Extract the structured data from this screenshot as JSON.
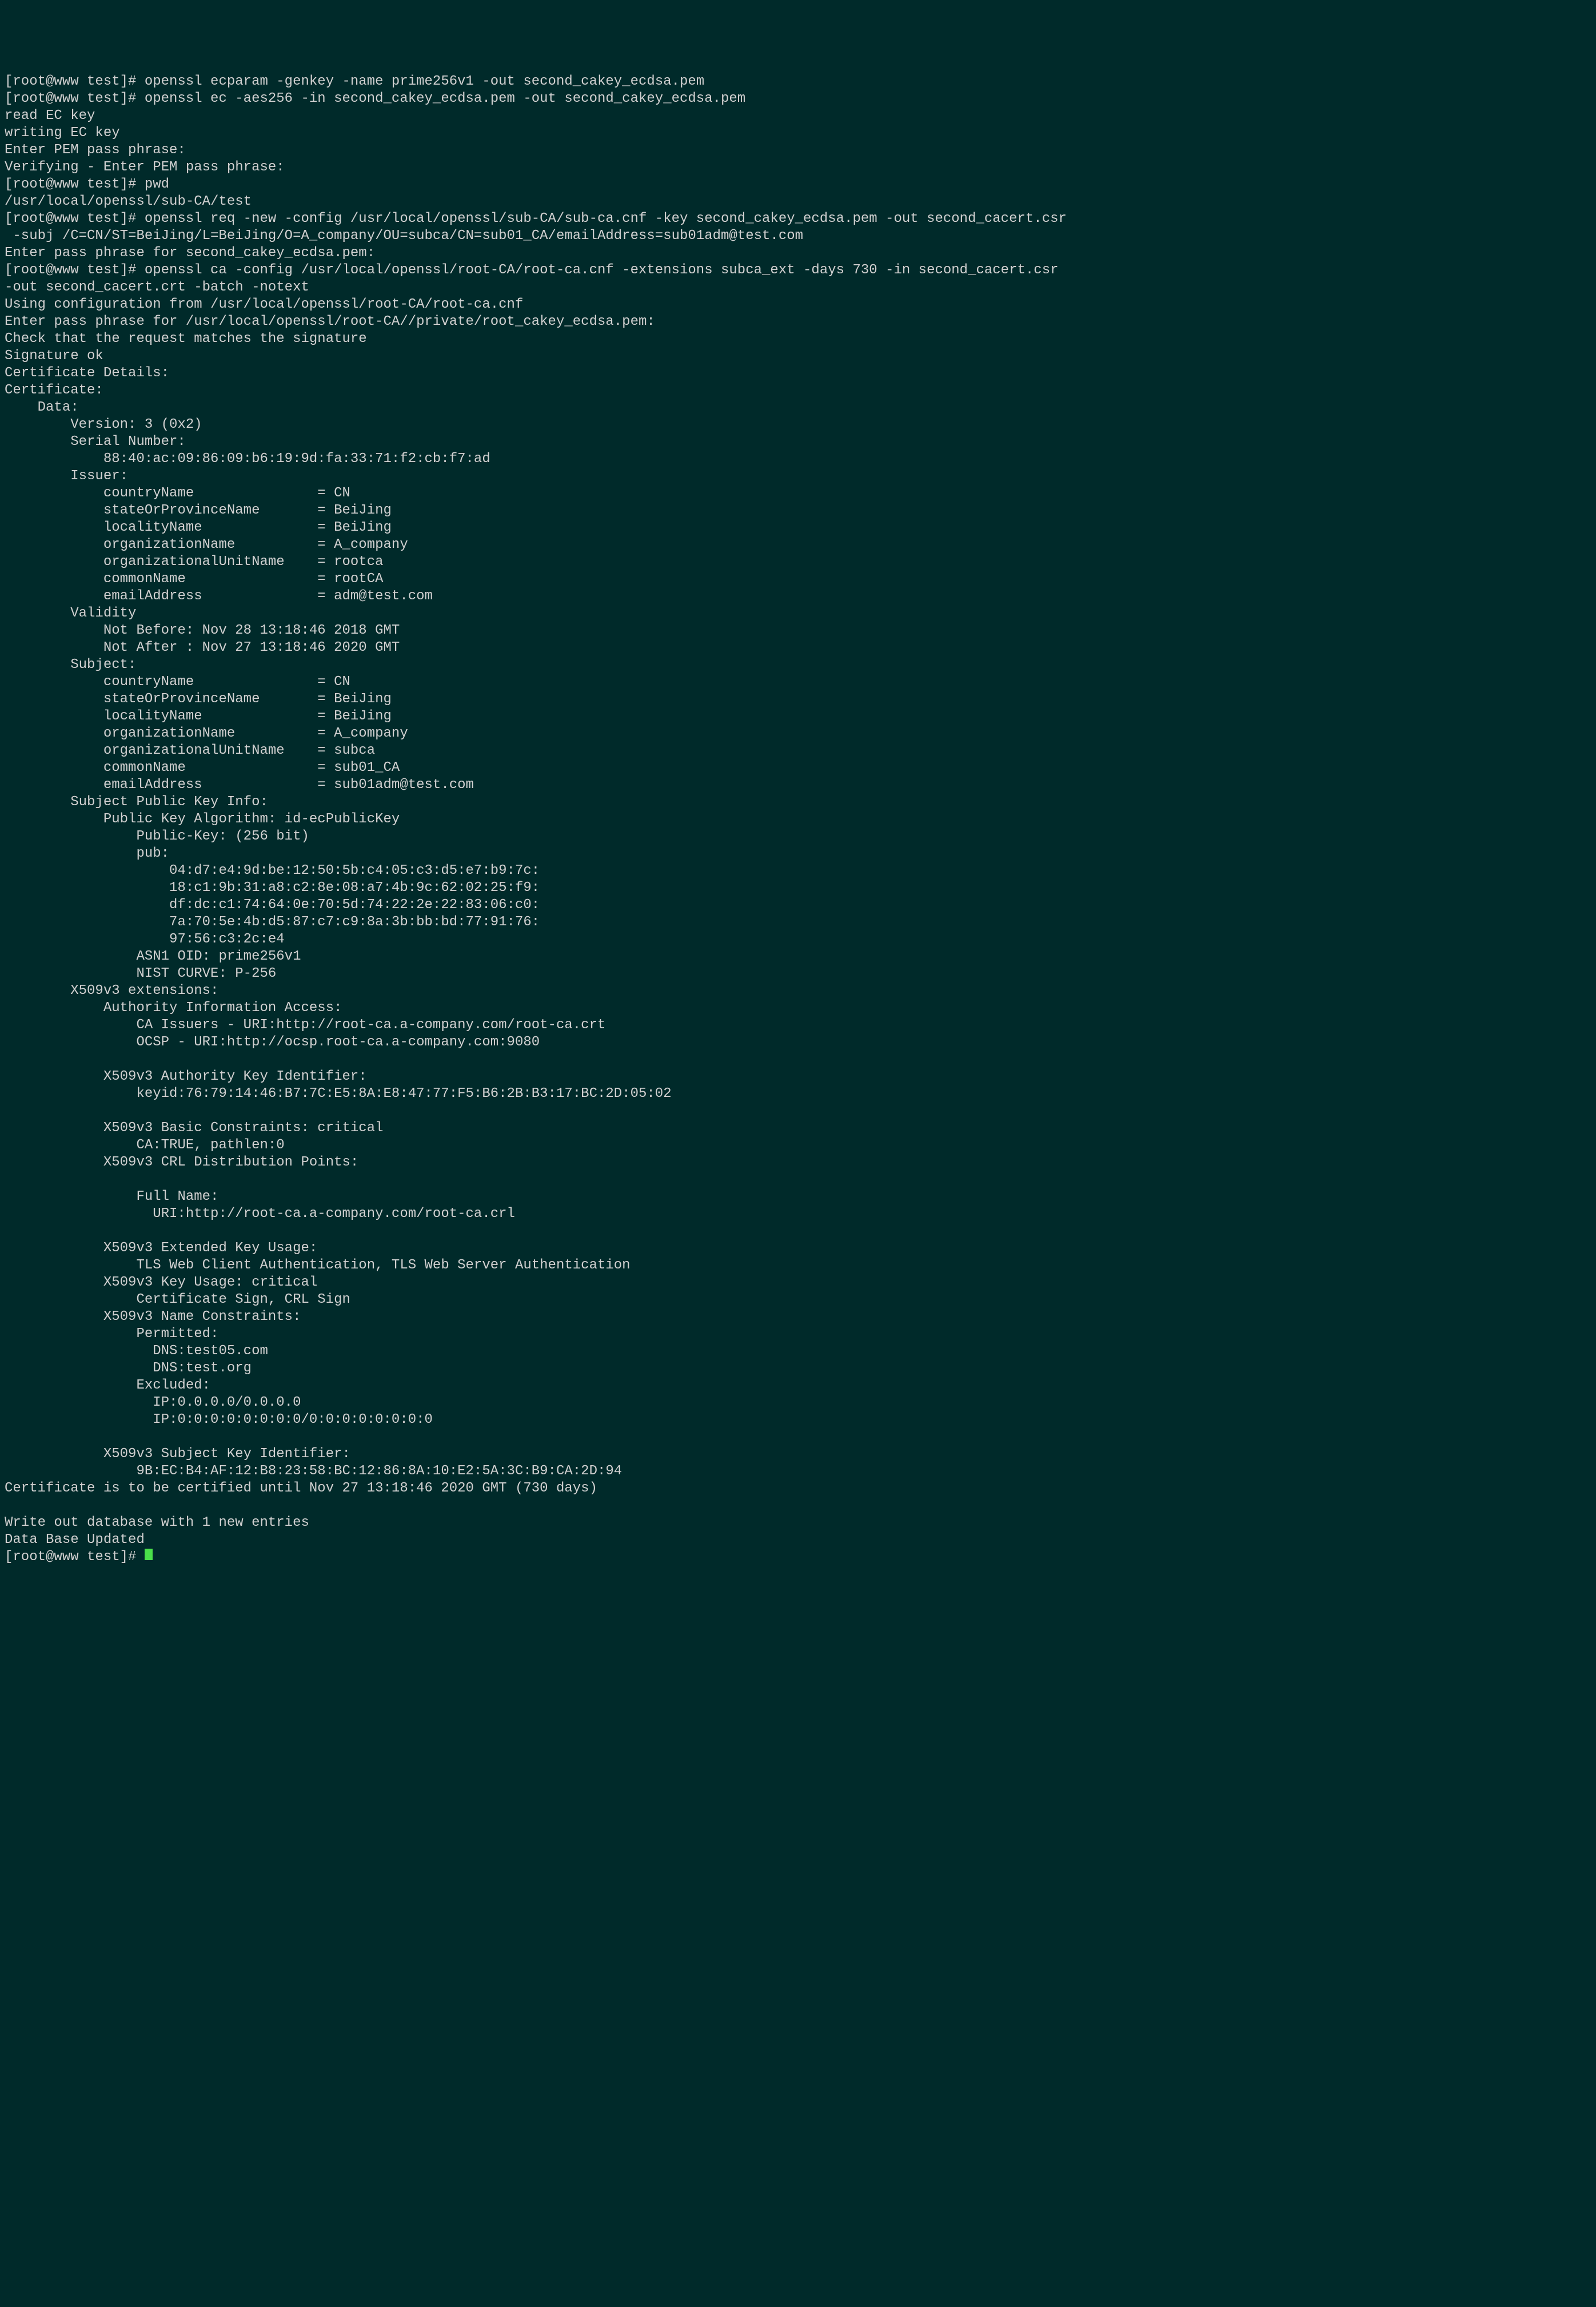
{
  "terminal": {
    "lines": [
      "[root@www test]# openssl ecparam -genkey -name prime256v1 -out second_cakey_ecdsa.pem",
      "[root@www test]# openssl ec -aes256 -in second_cakey_ecdsa.pem -out second_cakey_ecdsa.pem",
      "read EC key",
      "writing EC key",
      "Enter PEM pass phrase:",
      "Verifying - Enter PEM pass phrase:",
      "[root@www test]# pwd",
      "/usr/local/openssl/sub-CA/test",
      "[root@www test]# openssl req -new -config /usr/local/openssl/sub-CA/sub-ca.cnf -key second_cakey_ecdsa.pem -out second_cacert.csr",
      " -subj /C=CN/ST=BeiJing/L=BeiJing/O=A_company/OU=subca/CN=sub01_CA/emailAddress=sub01adm@test.com",
      "Enter pass phrase for second_cakey_ecdsa.pem:",
      "[root@www test]# openssl ca -config /usr/local/openssl/root-CA/root-ca.cnf -extensions subca_ext -days 730 -in second_cacert.csr",
      "-out second_cacert.crt -batch -notext",
      "Using configuration from /usr/local/openssl/root-CA/root-ca.cnf",
      "Enter pass phrase for /usr/local/openssl/root-CA//private/root_cakey_ecdsa.pem:",
      "Check that the request matches the signature",
      "Signature ok",
      "Certificate Details:",
      "Certificate:",
      "    Data:",
      "        Version: 3 (0x2)",
      "        Serial Number:",
      "            88:40:ac:09:86:09:b6:19:9d:fa:33:71:f2:cb:f7:ad",
      "        Issuer:",
      "            countryName               = CN",
      "            stateOrProvinceName       = BeiJing",
      "            localityName              = BeiJing",
      "            organizationName          = A_company",
      "            organizationalUnitName    = rootca",
      "            commonName                = rootCA",
      "            emailAddress              = adm@test.com",
      "        Validity",
      "            Not Before: Nov 28 13:18:46 2018 GMT",
      "            Not After : Nov 27 13:18:46 2020 GMT",
      "        Subject:",
      "            countryName               = CN",
      "            stateOrProvinceName       = BeiJing",
      "            localityName              = BeiJing",
      "            organizationName          = A_company",
      "            organizationalUnitName    = subca",
      "            commonName                = sub01_CA",
      "            emailAddress              = sub01adm@test.com",
      "        Subject Public Key Info:",
      "            Public Key Algorithm: id-ecPublicKey",
      "                Public-Key: (256 bit)",
      "                pub:",
      "                    04:d7:e4:9d:be:12:50:5b:c4:05:c3:d5:e7:b9:7c:",
      "                    18:c1:9b:31:a8:c2:8e:08:a7:4b:9c:62:02:25:f9:",
      "                    df:dc:c1:74:64:0e:70:5d:74:22:2e:22:83:06:c0:",
      "                    7a:70:5e:4b:d5:87:c7:c9:8a:3b:bb:bd:77:91:76:",
      "                    97:56:c3:2c:e4",
      "                ASN1 OID: prime256v1",
      "                NIST CURVE: P-256",
      "        X509v3 extensions:",
      "            Authority Information Access: ",
      "                CA Issuers - URI:http://root-ca.a-company.com/root-ca.crt",
      "                OCSP - URI:http://ocsp.root-ca.a-company.com:9080",
      "",
      "            X509v3 Authority Key Identifier: ",
      "                keyid:76:79:14:46:B7:7C:E5:8A:E8:47:77:F5:B6:2B:B3:17:BC:2D:05:02",
      "",
      "            X509v3 Basic Constraints: critical",
      "                CA:TRUE, pathlen:0",
      "            X509v3 CRL Distribution Points: ",
      "",
      "                Full Name:",
      "                  URI:http://root-ca.a-company.com/root-ca.crl",
      "",
      "            X509v3 Extended Key Usage: ",
      "                TLS Web Client Authentication, TLS Web Server Authentication",
      "            X509v3 Key Usage: critical",
      "                Certificate Sign, CRL Sign",
      "            X509v3 Name Constraints: ",
      "                Permitted:",
      "                  DNS:test05.com",
      "                  DNS:test.org",
      "                Excluded:",
      "                  IP:0.0.0.0/0.0.0.0",
      "                  IP:0:0:0:0:0:0:0:0/0:0:0:0:0:0:0:0",
      "",
      "            X509v3 Subject Key Identifier: ",
      "                9B:EC:B4:AF:12:B8:23:58:BC:12:86:8A:10:E2:5A:3C:B9:CA:2D:94",
      "Certificate is to be certified until Nov 27 13:18:46 2020 GMT (730 days)",
      "",
      "Write out database with 1 new entries",
      "Data Base Updated",
      "[root@www test]# "
    ]
  }
}
